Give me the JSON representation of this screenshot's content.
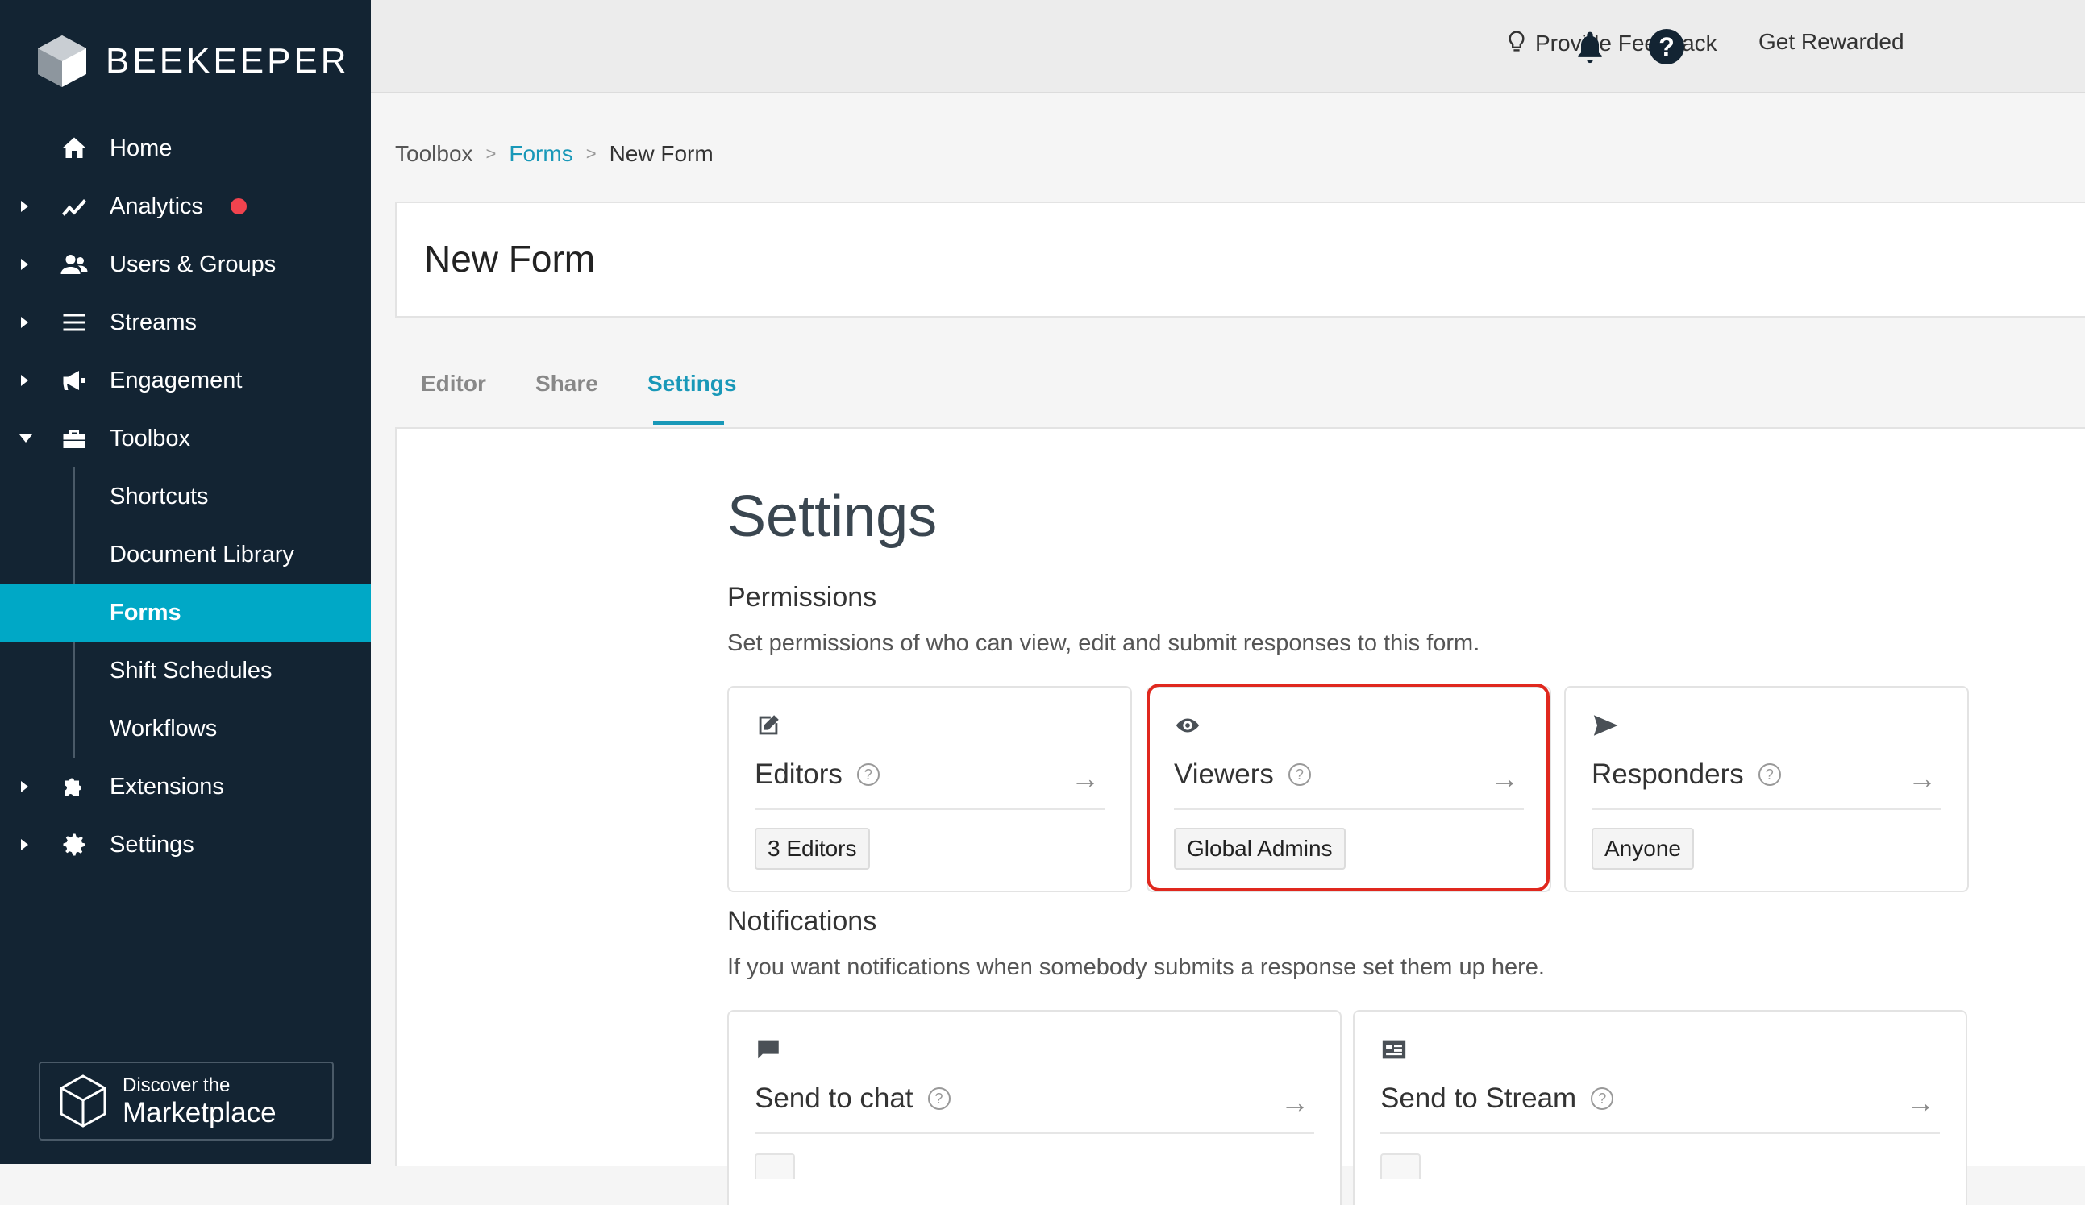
{
  "brand": {
    "name": "BEEKEEPER"
  },
  "sidebar": {
    "items": [
      {
        "label": "Home",
        "icon": "home-icon"
      },
      {
        "label": "Analytics",
        "icon": "analytics-icon"
      },
      {
        "label": "Users & Groups",
        "icon": "users-icon"
      },
      {
        "label": "Streams",
        "icon": "streams-icon"
      },
      {
        "label": "Engagement",
        "icon": "megaphone-icon"
      },
      {
        "label": "Toolbox",
        "icon": "toolbox-icon"
      },
      {
        "label": "Extensions",
        "icon": "puzzle-icon"
      },
      {
        "label": "Settings",
        "icon": "gear-icon"
      }
    ],
    "toolbox_sub": [
      "Shortcuts",
      "Document Library",
      "Forms",
      "Shift Schedules",
      "Workflows"
    ],
    "active_item": "Forms",
    "marketplace": {
      "line1": "Discover the",
      "line2": "Marketplace"
    }
  },
  "topbar": {
    "feedback": "Provide Feedback",
    "rewarded": "Get Rewarded",
    "help": "?"
  },
  "breadcrumb": {
    "items": [
      "Toolbox",
      "Forms",
      "New Form"
    ],
    "sep": ">"
  },
  "form": {
    "title": "New Form"
  },
  "tabs": [
    "Editor",
    "Share",
    "Settings"
  ],
  "active_tab": "Settings",
  "settings": {
    "heading": "Settings",
    "permissions": {
      "title": "Permissions",
      "desc": "Set permissions of who can view, edit and submit responses to this form.",
      "cards": [
        {
          "title": "Editors",
          "value": "3 Editors",
          "icon": "edit-icon"
        },
        {
          "title": "Viewers",
          "value": "Global Admins",
          "icon": "eye-icon"
        },
        {
          "title": "Responders",
          "value": "Anyone",
          "icon": "send-icon"
        }
      ]
    },
    "notifications": {
      "title": "Notifications",
      "desc": "If you want notifications when somebody submits a response set them up here.",
      "cards": [
        {
          "title": "Send to chat",
          "icon": "chat-icon"
        },
        {
          "title": "Send to Stream",
          "icon": "stream-card-icon"
        }
      ]
    }
  },
  "colors": {
    "sidebar": "#132433",
    "accent": "#00a8c6",
    "highlight": "#e0281e",
    "alert_dot": "#f0434e"
  }
}
